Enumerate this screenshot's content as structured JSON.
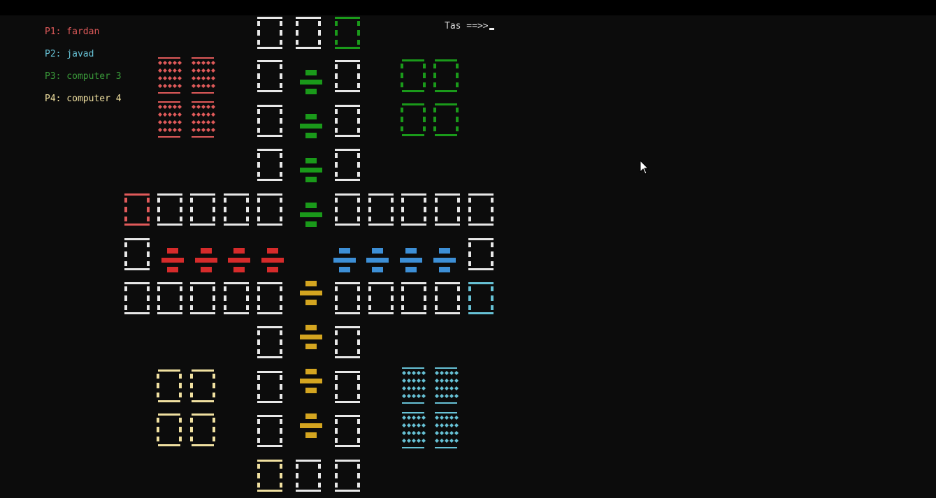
{
  "players": [
    {
      "label": "P1: fardan",
      "color": "#e05a5a"
    },
    {
      "label": "P2: javad",
      "color": "#67c2d6"
    },
    {
      "label": "P3: computer 3",
      "color": "#3a9a3a"
    },
    {
      "label": "P4: computer 4",
      "color": "#f0e0a0"
    }
  ],
  "prompt": "Tas ==>>",
  "colors": {
    "track": "#e8e8e8",
    "red": "#d62b2b",
    "blue": "#3d8fd6",
    "green": "#1a9a1a",
    "yellow": "#d4a520",
    "cyan": "#67c2d6",
    "cream": "#f0e0a0",
    "red_token": "#e05a5a"
  }
}
